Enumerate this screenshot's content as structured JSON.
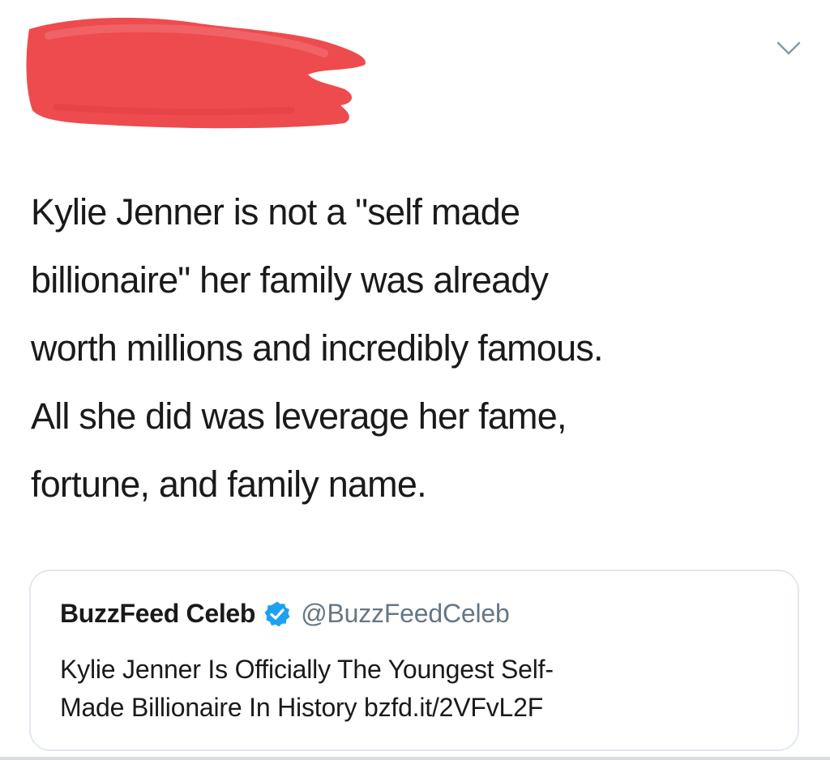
{
  "tweet": {
    "text": "Kylie Jenner is not a \"self made\nbillionaire\" her family was already\nworth millions and incredibly famous.\nAll she did was leverage her fame,\nfortune, and family name.",
    "menu_icon": "chevron-down-icon",
    "redaction_color": "#ee4b4e"
  },
  "quoted": {
    "name": "BuzzFeed Celeb",
    "verified_icon": "verified-badge-icon",
    "verified_color": "#1da1f2",
    "handle": "@BuzzFeedCeleb",
    "text": "Kylie Jenner Is Officially The Youngest Self-\nMade Billionaire In History bzfd.it/2VFvL2F"
  }
}
